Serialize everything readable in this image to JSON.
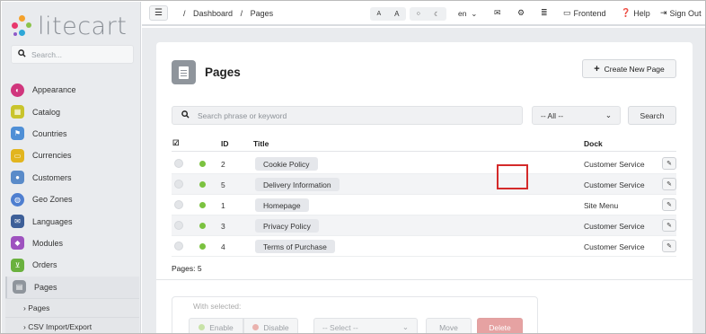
{
  "sidebar": {
    "logo_text": "litecart",
    "search_placeholder": "Search...",
    "items": [
      {
        "label": "Appearance",
        "icon": "appearance-icon",
        "color": "#d0367d"
      },
      {
        "label": "Catalog",
        "icon": "catalog-icon",
        "color": "#c9c42c"
      },
      {
        "label": "Countries",
        "icon": "flag-icon",
        "color": "#4f8fd6"
      },
      {
        "label": "Currencies",
        "icon": "money-icon",
        "color": "#e2b51f"
      },
      {
        "label": "Customers",
        "icon": "customers-icon",
        "color": "#5a8bc9"
      },
      {
        "label": "Geo Zones",
        "icon": "globe-icon",
        "color": "#4f7fd0"
      },
      {
        "label": "Languages",
        "icon": "chat-icon",
        "color": "#3d5f98"
      },
      {
        "label": "Modules",
        "icon": "modules-icon",
        "color": "#9e52bf"
      },
      {
        "label": "Orders",
        "icon": "cart-icon",
        "color": "#6ab13e"
      },
      {
        "label": "Pages",
        "icon": "page-icon",
        "color": "#8f959c"
      }
    ],
    "sub_items": [
      "Pages",
      "CSV Import/Export"
    ]
  },
  "topbar": {
    "breadcrumb": [
      "/",
      "Dashboard",
      "/",
      "Pages"
    ],
    "font_small": "A",
    "font_large": "A",
    "language": "en",
    "frontend_label": "Frontend",
    "help_label": "Help",
    "signout_label": "Sign Out"
  },
  "main": {
    "title": "Pages",
    "create_button": "Create New Page",
    "search_placeholder": "Search phrase or keyword",
    "filter_selected": "-- All --",
    "search_button": "Search",
    "columns": {
      "id": "ID",
      "title": "Title",
      "dock": "Dock"
    },
    "rows": [
      {
        "id": "2",
        "title": "Cookie Policy",
        "dock": "Customer Service"
      },
      {
        "id": "5",
        "title": "Delivery Information",
        "dock": "Customer Service"
      },
      {
        "id": "1",
        "title": "Homepage",
        "dock": "Site Menu"
      },
      {
        "id": "3",
        "title": "Privacy Policy",
        "dock": "Customer Service"
      },
      {
        "id": "4",
        "title": "Terms of Purchase",
        "dock": "Customer Service"
      }
    ],
    "pages_count": "Pages: 5",
    "bulk": {
      "label": "With selected:",
      "enable": "Enable",
      "disable": "Disable",
      "select_placeholder": "-- Select --",
      "move": "Move",
      "delete": "Delete"
    }
  },
  "colors": {
    "enabled_status": "#7bc240",
    "highlight": "#d42a2a",
    "delete": "#e6a2a2"
  }
}
